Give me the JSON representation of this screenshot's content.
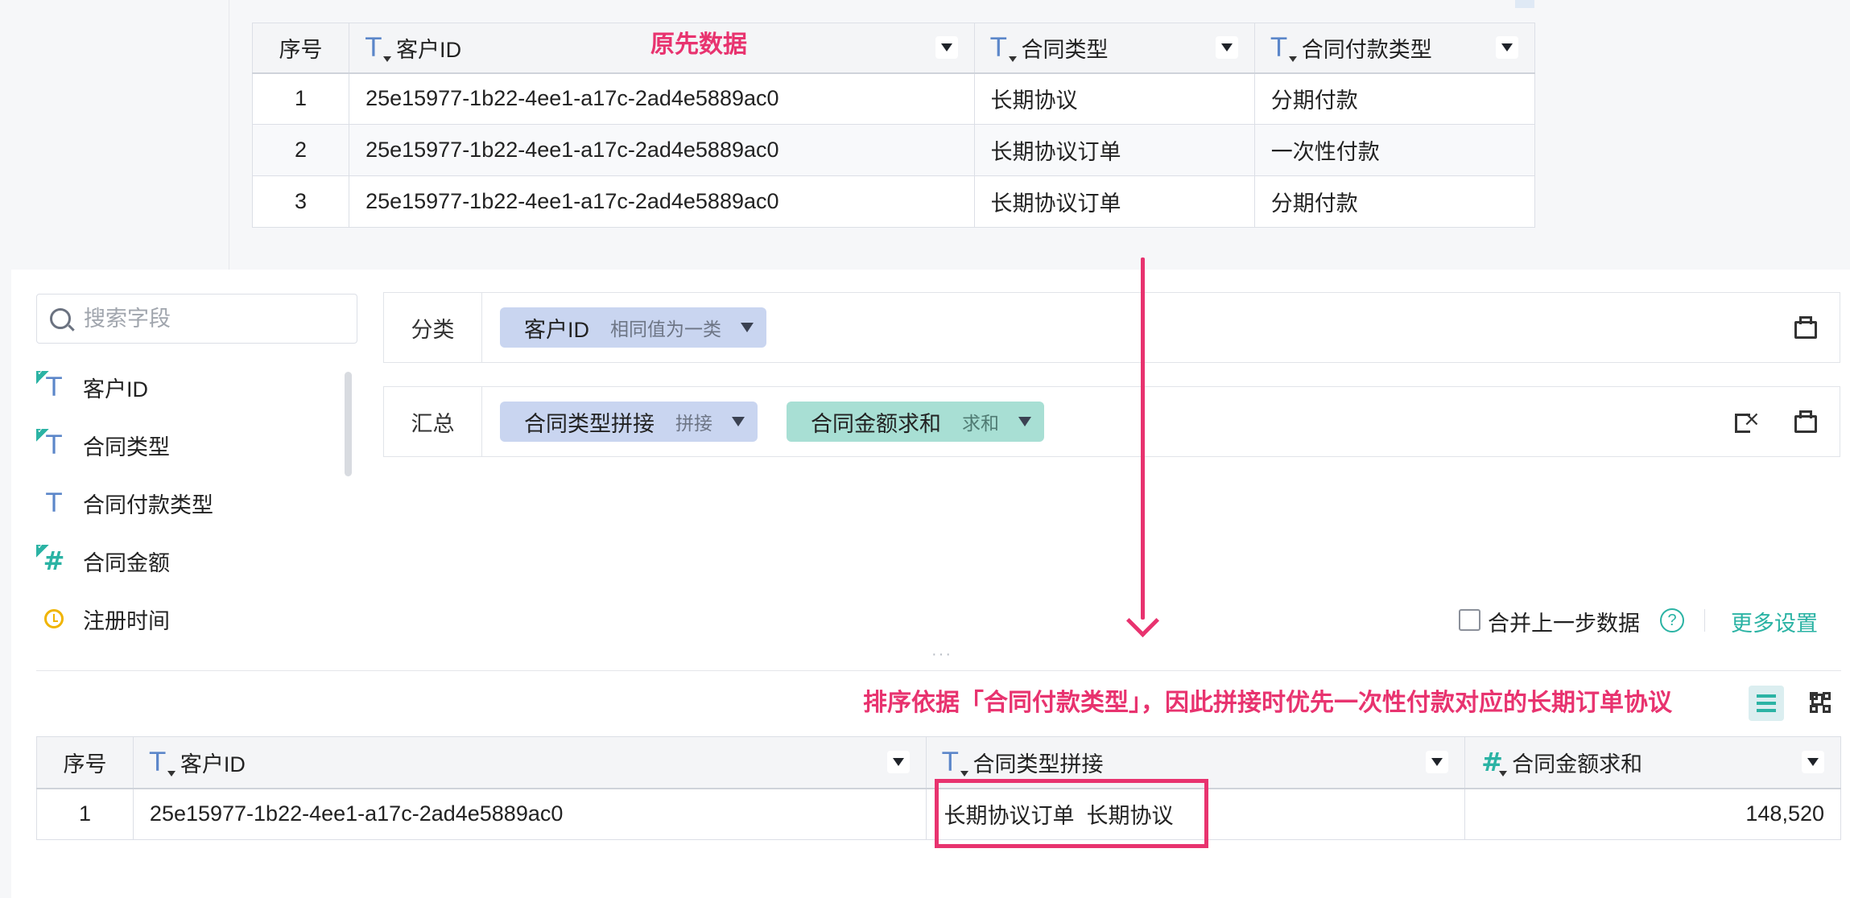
{
  "annotations": {
    "original_data": "原先数据",
    "sort_note": "排序依据「合同付款类型」，因此拼接时优先一次性付款对应的长期订单协议"
  },
  "original_table": {
    "headers": [
      "序号",
      "客户ID",
      "合同类型",
      "合同付款类型"
    ],
    "rows": [
      [
        "1",
        "25e15977-1b22-4ee1-a17c-2ad4e5889ac0",
        "长期协议",
        "分期付款"
      ],
      [
        "2",
        "25e15977-1b22-4ee1-a17c-2ad4e5889ac0",
        "长期协议订单",
        "一次性付款"
      ],
      [
        "3",
        "25e15977-1b22-4ee1-a17c-2ad4e5889ac0",
        "长期协议订单",
        "分期付款"
      ]
    ]
  },
  "field_panel": {
    "search_placeholder": "搜索字段",
    "fields": [
      {
        "label": "客户ID",
        "icon": "text-field-icon"
      },
      {
        "label": "合同类型",
        "icon": "text-field-icon"
      },
      {
        "label": "合同付款类型",
        "icon": "text-field-icon"
      },
      {
        "label": "合同金额",
        "icon": "number-field-icon"
      },
      {
        "label": "注册时间",
        "icon": "clock-icon"
      }
    ]
  },
  "config": {
    "group_label": "分类",
    "group_chip": {
      "name": "客户ID",
      "mode": "相同值为一类"
    },
    "summary_label": "汇总",
    "summary_chips": [
      {
        "name": "合同类型拼接",
        "mode": "拼接"
      },
      {
        "name": "合同金额求和",
        "mode": "求和"
      }
    ]
  },
  "options": {
    "merge_label": "合并上一步数据",
    "help": "?",
    "more_settings": "更多设置",
    "splitter": "···"
  },
  "result_table": {
    "headers": [
      "序号",
      "客户ID",
      "合同类型拼接",
      "合同金额求和"
    ],
    "rows": [
      [
        "1",
        "25e15977-1b22-4ee1-a17c-2ad4e5889ac0",
        "长期协议订单  长期协议",
        "148,520"
      ]
    ]
  },
  "colors": {
    "accent": "#2bb3a4",
    "annotation": "#e8336f",
    "text_field": "#5b86c9"
  }
}
